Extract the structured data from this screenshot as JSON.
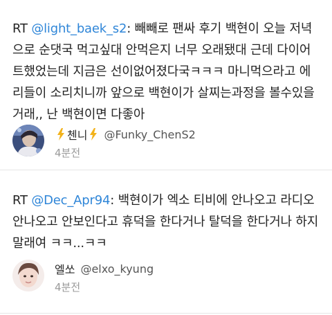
{
  "tweets": [
    {
      "rt_prefix": "RT ",
      "mention": "@light_baek_s2",
      "text": ": 빼빼로 팬싸 후기 백현이 오늘 저녁으로 순댓국 먹고싶대 안먹은지 너무 오래됐대 근데 다이어트했었는데 지금은 선이없어졌다국ㅋㅋㅋ 마니먹으라고 에리들이 소리치니까 앞으로 백현이가 살찌는과정을 볼수있을거래,, 난 백현이면 다좋아",
      "display_name": "첸니",
      "handle": "@Funky_ChenS2",
      "time": "4분전",
      "bolt_icon": "lightning-bolt-icon",
      "accent": "#f2b21b"
    },
    {
      "rt_prefix": "RT ",
      "mention": "@Dec_Apr94",
      "text": ": 백현이가 엑소 티비에 안나오고 라디오 안나오고 안보인다고 휴덕을 한다거나 탈덕을 한다거나 하지 말래여 ㅋㅋ...ㅋㅋ",
      "display_name": "엘쏘",
      "handle": "@elxo_kyung",
      "time": "4분전"
    }
  ],
  "colors": {
    "mention": "#2f86d8",
    "timestamp": "#9a9a9a",
    "divider": "#e6e6e6"
  }
}
